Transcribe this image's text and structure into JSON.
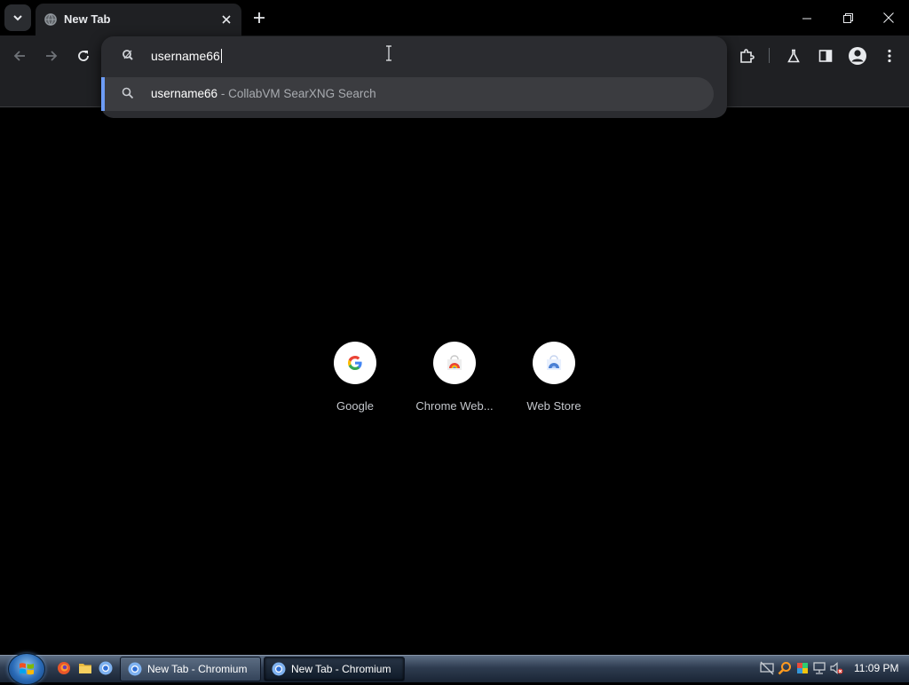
{
  "browser": {
    "tab": {
      "title": "New Tab"
    },
    "omnibox": {
      "value": "username66"
    },
    "suggestion": {
      "query": "username66",
      "separator": "-",
      "engine": "CollabVM SearXNG Search"
    }
  },
  "shortcuts": [
    {
      "label": "Google",
      "icon": "google-g-icon"
    },
    {
      "label": "Chrome Web...",
      "icon": "chrome-web-store-icon"
    },
    {
      "label": "Web Store",
      "icon": "web-store-icon"
    }
  ],
  "taskbar": {
    "tasks": [
      {
        "label": "New Tab - Chromium"
      },
      {
        "label": "New Tab - Chromium"
      }
    ],
    "clock": "11:09 PM"
  },
  "colors": {
    "page_background": "#000000",
    "toolbar": "#1f2023",
    "omnibox_popup": "#2b2c30",
    "selected_suggestion": "#3b3c40",
    "accent_blue": "#6d9cf6"
  }
}
